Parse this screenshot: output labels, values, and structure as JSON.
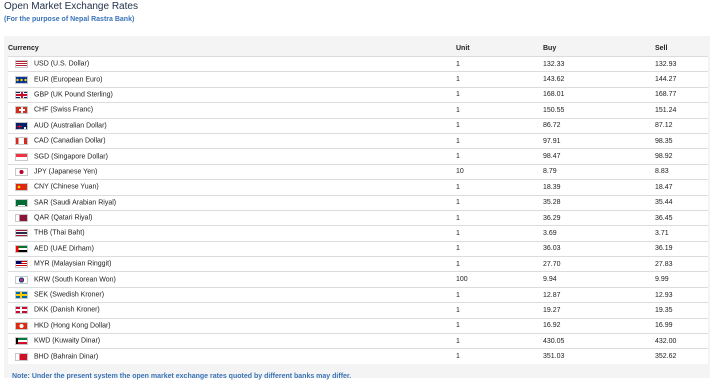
{
  "header": {
    "title": "Open Market Exchange Rates",
    "subtitle": "(For the purpose of Nepal Rastra Bank)"
  },
  "table": {
    "columns": [
      "Currency",
      "Unit",
      "Buy",
      "Sell"
    ],
    "rows": [
      {
        "flag": "us-flag",
        "currency": "USD (U.S. Dollar)",
        "unit": "1",
        "buy": "132.33",
        "sell": "132.93"
      },
      {
        "flag": "eu-flag",
        "currency": "EUR (European Euro)",
        "unit": "1",
        "buy": "143.62",
        "sell": "144.27"
      },
      {
        "flag": "gb-flag",
        "currency": "GBP (UK Pound Sterling)",
        "unit": "1",
        "buy": "168.01",
        "sell": "168.77"
      },
      {
        "flag": "ch-flag",
        "currency": "CHF (Swiss Franc)",
        "unit": "1",
        "buy": "150.55",
        "sell": "151.24"
      },
      {
        "flag": "au-flag",
        "currency": "AUD (Australian Dollar)",
        "unit": "1",
        "buy": "86.72",
        "sell": "87.12"
      },
      {
        "flag": "ca-flag",
        "currency": "CAD (Canadian Dollar)",
        "unit": "1",
        "buy": "97.91",
        "sell": "98.35"
      },
      {
        "flag": "sg-flag",
        "currency": "SGD (Singapore Dollar)",
        "unit": "1",
        "buy": "98.47",
        "sell": "98.92"
      },
      {
        "flag": "jp-flag",
        "currency": "JPY (Japanese Yen)",
        "unit": "10",
        "buy": "8.79",
        "sell": "8.83"
      },
      {
        "flag": "cn-flag",
        "currency": "CNY (Chinese Yuan)",
        "unit": "1",
        "buy": "18.39",
        "sell": "18.47"
      },
      {
        "flag": "sa-flag",
        "currency": "SAR (Saudi Arabian Riyal)",
        "unit": "1",
        "buy": "35.28",
        "sell": "35.44"
      },
      {
        "flag": "qa-flag",
        "currency": "QAR (Qatari Riyal)",
        "unit": "1",
        "buy": "36.29",
        "sell": "36.45"
      },
      {
        "flag": "th-flag",
        "currency": "THB (Thai Baht)",
        "unit": "1",
        "buy": "3.69",
        "sell": "3.71"
      },
      {
        "flag": "ae-flag",
        "currency": "AED (UAE Dirham)",
        "unit": "1",
        "buy": "36.03",
        "sell": "36.19"
      },
      {
        "flag": "my-flag",
        "currency": "MYR (Malaysian Ringgit)",
        "unit": "1",
        "buy": "27.70",
        "sell": "27.83"
      },
      {
        "flag": "kr-flag",
        "currency": "KRW (South Korean Won)",
        "unit": "100",
        "buy": "9.94",
        "sell": "9.99"
      },
      {
        "flag": "se-flag",
        "currency": "SEK (Swedish Kroner)",
        "unit": "1",
        "buy": "12.87",
        "sell": "12.93"
      },
      {
        "flag": "dk-flag",
        "currency": "DKK (Danish Kroner)",
        "unit": "1",
        "buy": "19.27",
        "sell": "19.35"
      },
      {
        "flag": "hk-flag",
        "currency": "HKD (Hong Kong Dollar)",
        "unit": "1",
        "buy": "16.92",
        "sell": "16.99"
      },
      {
        "flag": "kw-flag",
        "currency": "KWD (Kuwaity Dinar)",
        "unit": "1",
        "buy": "430.05",
        "sell": "432.00"
      },
      {
        "flag": "bh-flag",
        "currency": "BHD (Bahrain Dinar)",
        "unit": "1",
        "buy": "351.03",
        "sell": "352.62"
      }
    ]
  },
  "note": "Note: Under the present system the open market exchange rates quoted by different banks may differ.",
  "colors": {
    "title": "#1f2f4a",
    "link_blue": "#3a73b6",
    "panel": "#f4f4f4",
    "row_border": "#dcdcdc"
  }
}
